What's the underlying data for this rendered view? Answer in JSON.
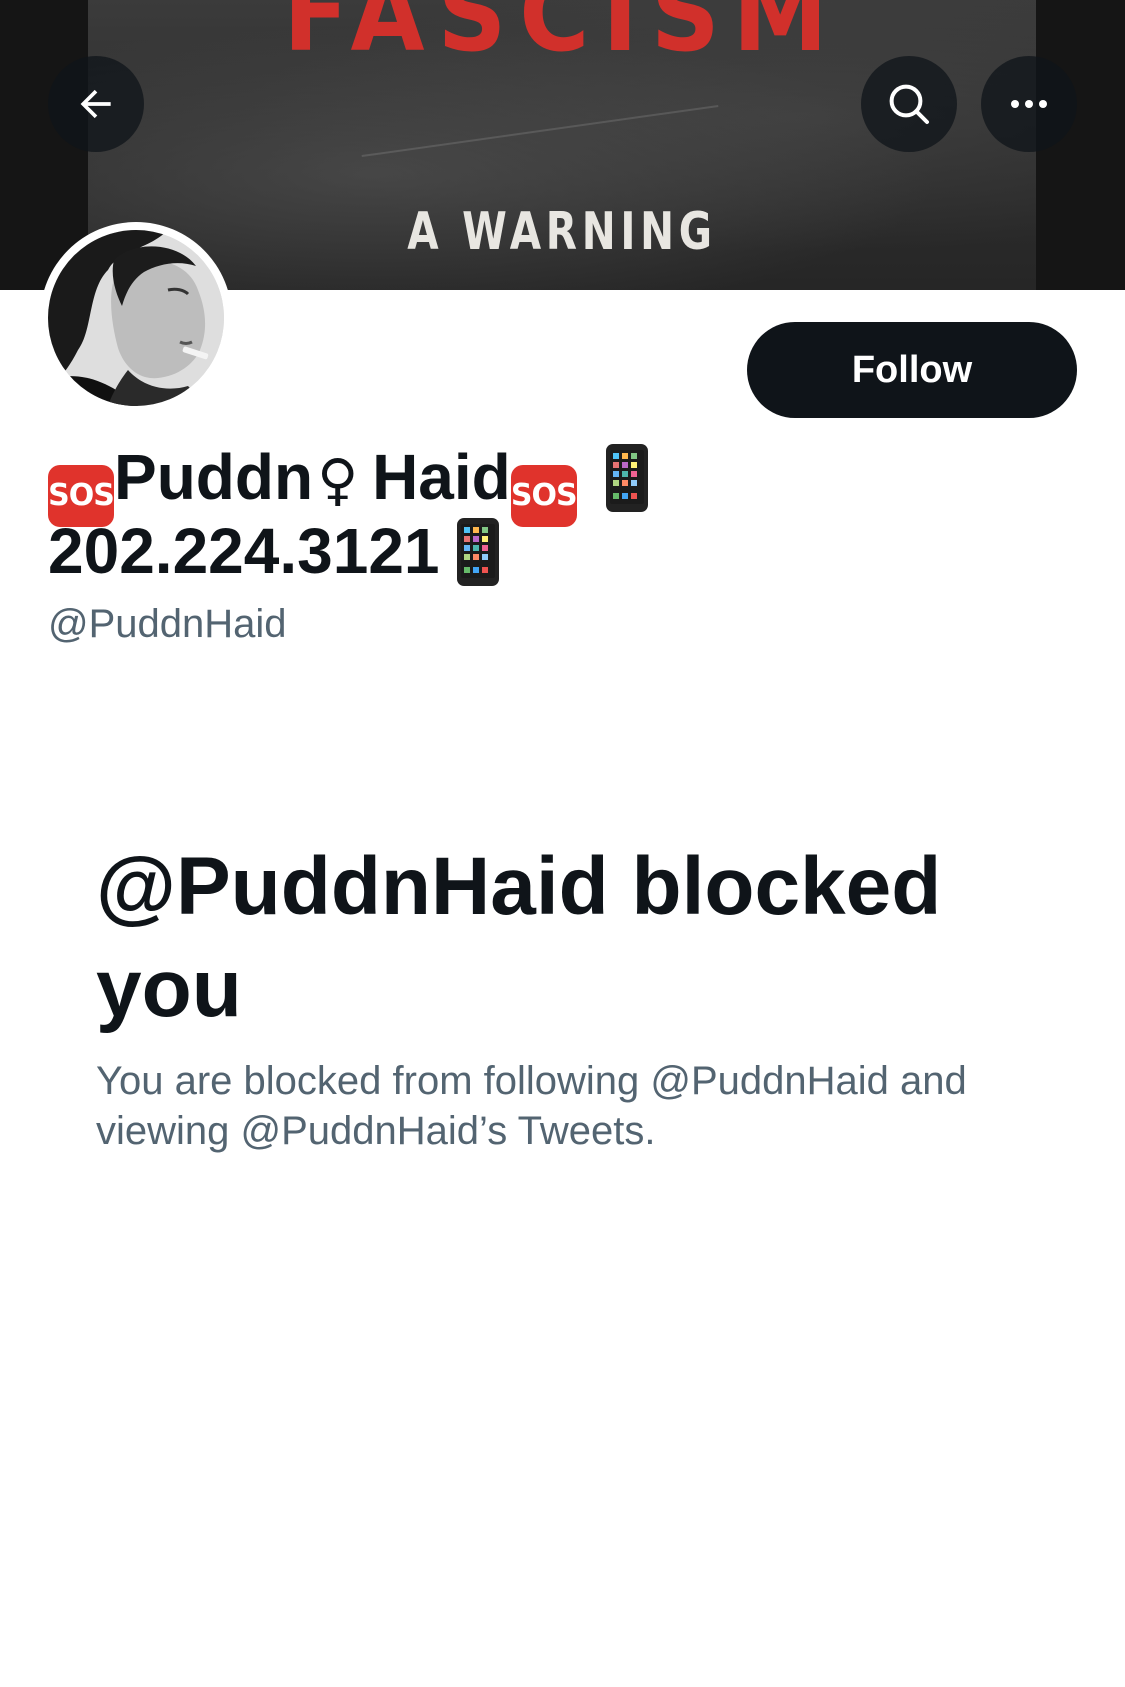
{
  "banner": {
    "cover_title": "FASCISM",
    "cover_subtitle": "A WARNING"
  },
  "header": {
    "back_icon": "arrow-left-icon",
    "search_icon": "search-icon",
    "more_icon": "more-horizontal-icon"
  },
  "profile": {
    "name_parts": {
      "sos_left": "SOS",
      "first": "Puddn",
      "female_sign": "♀",
      "last": "Haid",
      "sos_right": "SOS",
      "phone": "202.224.3121"
    },
    "handle": "@PuddnHaid",
    "follow_label": "Follow"
  },
  "blocked": {
    "title": "@PuddnHaid blocked you",
    "description": "You are blocked from following @PuddnHaid and viewing @PuddnHaid’s Tweets."
  },
  "colors": {
    "text_primary": "#0f1419",
    "text_secondary": "#536471",
    "sos_red": "#e0332c",
    "cover_red": "#d1302b"
  }
}
